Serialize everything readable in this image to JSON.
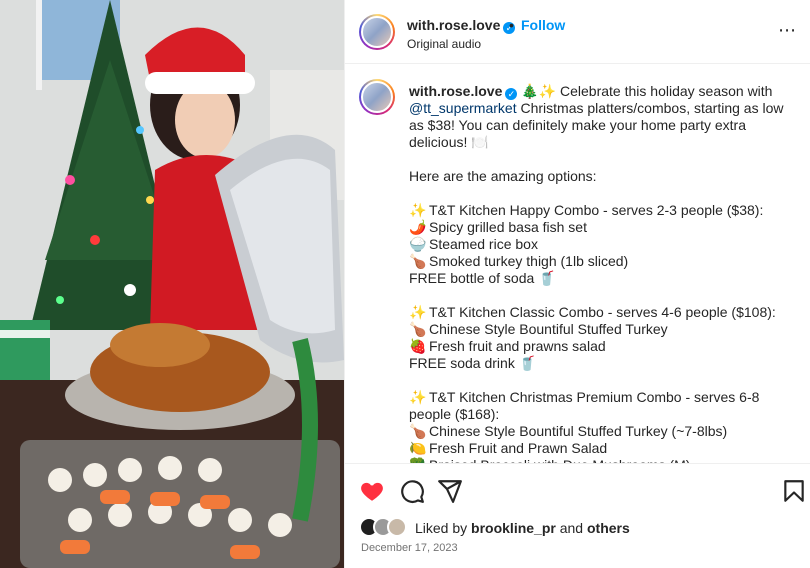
{
  "post": {
    "username": "with.rose.love",
    "follow_label": "Follow",
    "dot": "•",
    "audio": "Original audio",
    "more_icon": "⋯"
  },
  "caption": {
    "username": "with.rose.love",
    "intro_emojis": "🎄✨",
    "intro_text": " Celebrate this holiday season with ",
    "mention": "@tt_supermarket",
    "intro_rest": " Christmas platters/combos, starting as low as $38! You can definitely make your home party extra delicious! 🍽️",
    "options_heading": "Here are the amazing options:",
    "combos": [
      {
        "title": "T&T Kitchen Happy Combo - serves 2-3 people ($38):",
        "items": [
          {
            "emoji": "🌶️",
            "text": "Spicy grilled basa fish set"
          },
          {
            "emoji": "🍚",
            "text": "Steamed rice box"
          },
          {
            "emoji": "🍗",
            "text": "Smoked turkey thigh (1lb sliced)"
          }
        ],
        "extra": "FREE bottle of soda 🥤"
      },
      {
        "title": "T&T Kitchen Classic Combo - serves 4-6 people ($108):",
        "items": [
          {
            "emoji": "🍗",
            "text": "Chinese Style Bountiful Stuffed Turkey"
          },
          {
            "emoji": "🍓",
            "text": "Fresh fruit and prawns salad"
          }
        ],
        "extra": "FREE soda drink 🥤"
      },
      {
        "title": "T&T Kitchen Christmas Premium Combo - serves 6-8 people ($168):",
        "items": [
          {
            "emoji": "🍗",
            "text": "Chinese Style Bountiful Stuffed Turkey (~7-8lbs)"
          },
          {
            "emoji": "🍋",
            "text": "Fresh Fruit and Prawn Salad"
          },
          {
            "emoji": "🥦",
            "text": "Braised Broccoli with Duo Mushrooms (M)"
          }
        ],
        "extra": ""
      }
    ],
    "combo_emoji": "✨"
  },
  "engagement": {
    "liked_by_prefix": "Liked by ",
    "liked_by_user": "brookline_pr",
    "liked_by_and": " and ",
    "liked_by_others": "others",
    "date": "December 17, 2023"
  },
  "icons": {
    "like": "heart-icon",
    "comment": "comment-icon",
    "share": "share-icon",
    "save": "bookmark-icon"
  },
  "colors": {
    "accent": "#0095f6",
    "like": "#ff3040",
    "mention": "#00376b"
  }
}
